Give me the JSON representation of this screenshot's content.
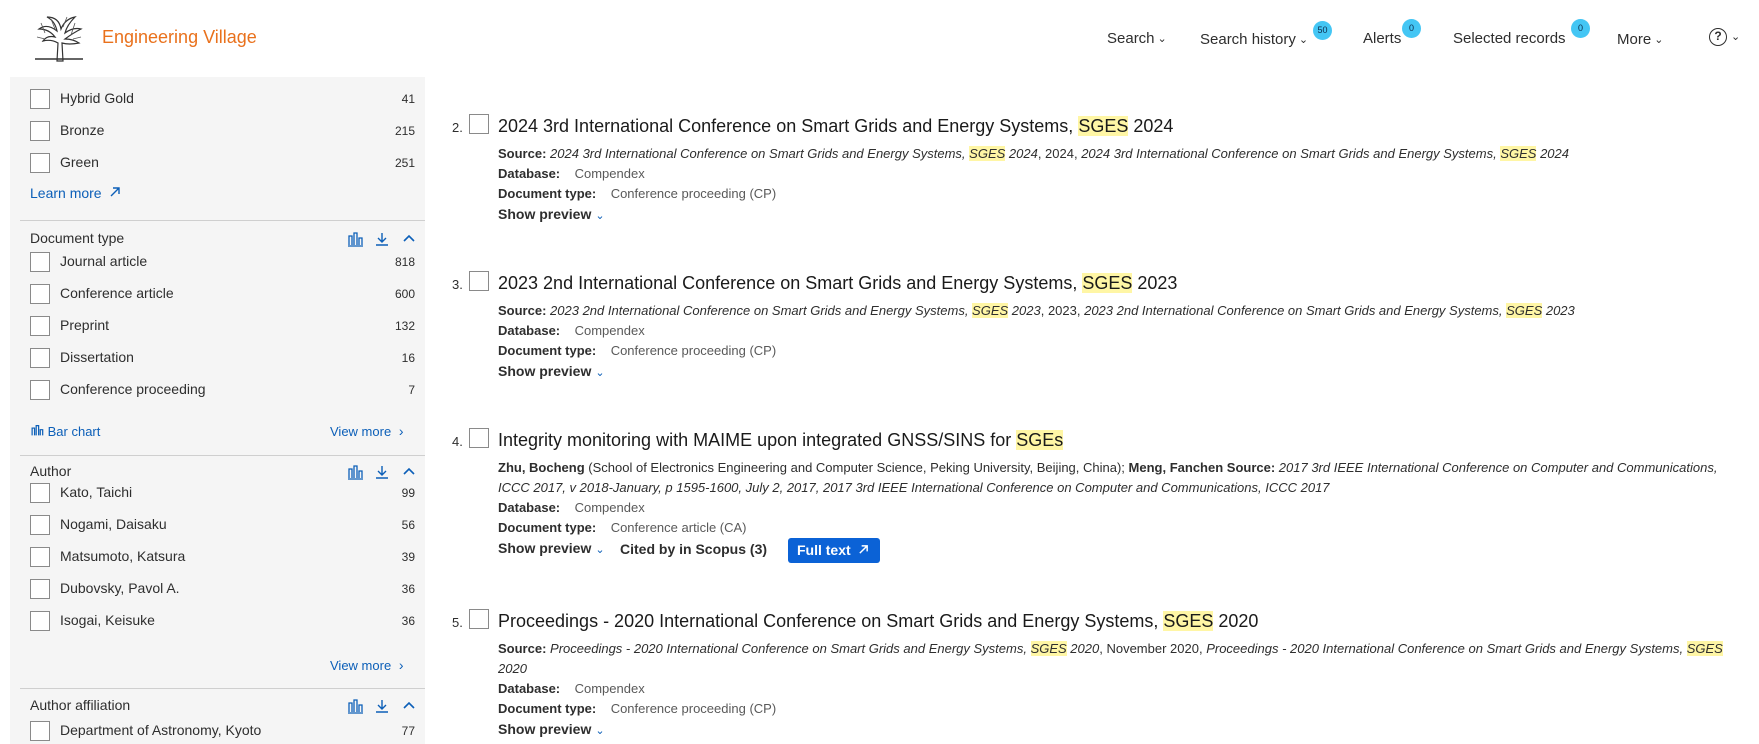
{
  "header": {
    "brand": "Engineering Village",
    "nav": {
      "search": "Search",
      "search_history": "Search history",
      "search_history_count": "50",
      "alerts": "Alerts",
      "alerts_count": "0",
      "selected_records": "Selected records",
      "selected_records_count": "0",
      "more": "More"
    },
    "icons": [
      "elsevier-tree-logo",
      "chevron-down-icon",
      "help-icon"
    ]
  },
  "sidebar": {
    "access_items": [
      {
        "label": "Hybrid Gold",
        "count": "41"
      },
      {
        "label": "Bronze",
        "count": "215"
      },
      {
        "label": "Green",
        "count": "251"
      }
    ],
    "learn_more": "Learn more",
    "document_type": {
      "title": "Document type",
      "items": [
        {
          "label": "Journal article",
          "count": "818"
        },
        {
          "label": "Conference article",
          "count": "600"
        },
        {
          "label": "Preprint",
          "count": "132"
        },
        {
          "label": "Dissertation",
          "count": "16"
        },
        {
          "label": "Conference proceeding",
          "count": "7"
        }
      ],
      "bar_chart": "Bar chart",
      "view_more": "View more"
    },
    "author": {
      "title": "Author",
      "items": [
        {
          "label": "Kato, Taichi",
          "count": "99"
        },
        {
          "label": "Nogami, Daisaku",
          "count": "56"
        },
        {
          "label": "Matsumoto, Katsura",
          "count": "39"
        },
        {
          "label": "Dubovsky, Pavol A.",
          "count": "36"
        },
        {
          "label": "Isogai, Keisuke",
          "count": "36"
        }
      ],
      "view_more": "View more"
    },
    "author_affiliation": {
      "title": "Author affiliation",
      "items": [
        {
          "label": "Department of Astronomy, Kyoto",
          "count": "77"
        }
      ]
    }
  },
  "results": [
    {
      "num": "2.",
      "title_pre": "2024 3rd International Conference on Smart Grids and Energy Systems, ",
      "title_hl": "SGES",
      "title_post": " 2024",
      "source_label": "Source:",
      "source_1": "2024 3rd International Conference on Smart Grids and Energy Systems, ",
      "source_hl": "SGES",
      "source_2": " 2024",
      "source_3": ", 2024, ",
      "source_4": "2024 3rd International Conference on Smart Grids and Energy Systems, ",
      "source_5": " 2024",
      "database_label": "Database:",
      "database": "Compendex",
      "doctype_label": "Document type:",
      "doctype": "Conference proceeding (CP)",
      "show_preview": "Show preview"
    },
    {
      "num": "3.",
      "title_pre": "2023 2nd International Conference on Smart Grids and Energy Systems, ",
      "title_hl": "SGES",
      "title_post": " 2023",
      "source_label": "Source:",
      "source_1": "2023 2nd International Conference on Smart Grids and Energy Systems, ",
      "source_hl": "SGES",
      "source_2": " 2023",
      "source_3": ", 2023, ",
      "source_4": "2023 2nd International Conference on Smart Grids and Energy Systems, ",
      "source_5": " 2023",
      "database_label": "Database:",
      "database": "Compendex",
      "doctype_label": "Document type:",
      "doctype": "Conference proceeding (CP)",
      "show_preview": "Show preview"
    },
    {
      "num": "4.",
      "title_pre": "Integrity monitoring with MAIME upon integrated GNSS/SINS for ",
      "title_hl": "SGEs",
      "title_post": "",
      "author1": "Zhu, Bocheng",
      "affiliation": " (School of Electronics Engineering and Computer Science, Peking University, Beijing, China); ",
      "author2": "Meng, Fanchen",
      "source_label": " Source:",
      "source_text": " 2017 3rd IEEE International Conference on Computer and Communications, ICCC 2017, v 2018-January, p 1595-1600, July 2, 2017, 2017 3rd IEEE International Conference on Computer and Communications, ICCC 2017",
      "database_label": "Database:",
      "database": "Compendex",
      "doctype_label": "Document type:",
      "doctype": "Conference article (CA)",
      "show_preview": "Show preview",
      "cited_by": "Cited by in Scopus (3)",
      "full_text": "Full text"
    },
    {
      "num": "5.",
      "title_pre": "Proceedings - 2020 International Conference on Smart Grids and Energy Systems, ",
      "title_hl": "SGES",
      "title_post": " 2020",
      "source_label": "Source:",
      "source_1": "Proceedings - 2020 International Conference on Smart Grids and Energy Systems, ",
      "source_hl": "SGES",
      "source_2": " 2020",
      "source_3": ", November 2020, ",
      "source_4": "Proceedings - 2020 International Conference on Smart Grids and Energy Systems, ",
      "source_5": " 2020",
      "database_label": "Database:",
      "database": "Compendex",
      "doctype_label": "Document type:",
      "doctype": "Conference proceeding (CP)",
      "show_preview": "Show preview"
    }
  ],
  "colors": {
    "brand": "#e9711c",
    "link": "#0c5fb8",
    "badge": "#44c6f4",
    "highlight": "#fff6a5",
    "button": "#0b62d6"
  }
}
